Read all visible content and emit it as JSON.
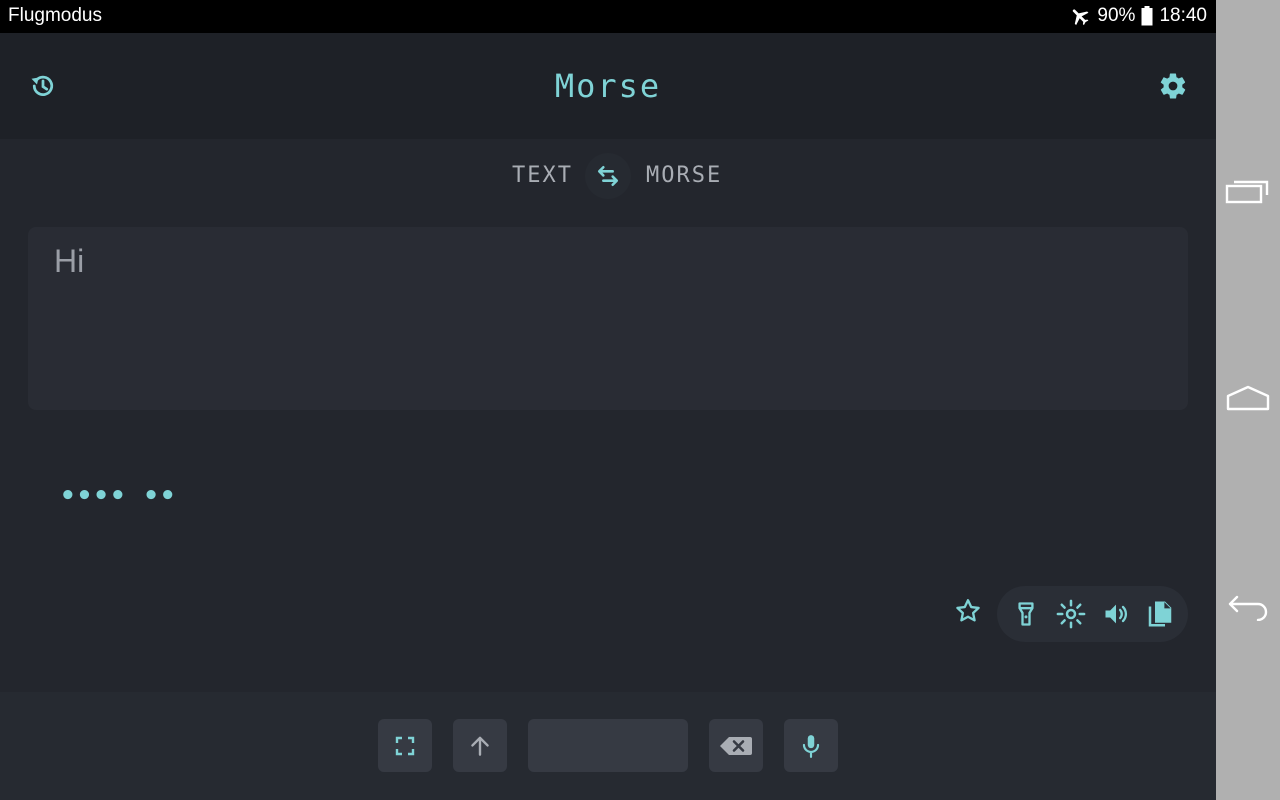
{
  "status_bar": {
    "left_text": "Flugmodus",
    "battery": "90%",
    "time": "18:40",
    "icons": [
      "airplane-icon",
      "battery-icon"
    ]
  },
  "app": {
    "title": "Morse",
    "history_icon": "history-icon",
    "settings_icon": "gear-icon"
  },
  "mode": {
    "source": "TEXT",
    "target": "MORSE",
    "swap_icon": "swap-arrows-icon"
  },
  "input": {
    "value": "Hi"
  },
  "output": {
    "morse": "•••• ••"
  },
  "actions": {
    "icons": [
      "star-icon",
      "flashlight-icon",
      "screen-flash-icon",
      "volume-icon",
      "copy-icon"
    ]
  },
  "keyboard": {
    "icons": [
      "fullscreen-icon",
      "arrow-up-icon",
      "space-key",
      "backspace-icon",
      "microphone-icon"
    ]
  },
  "navigation": {
    "icons": [
      "recent-apps-icon",
      "home-icon",
      "back-icon"
    ]
  },
  "colors": {
    "accent": "#7fd3d6",
    "background": "#1e2127",
    "panel": "#292c34",
    "button": "#363a43"
  }
}
